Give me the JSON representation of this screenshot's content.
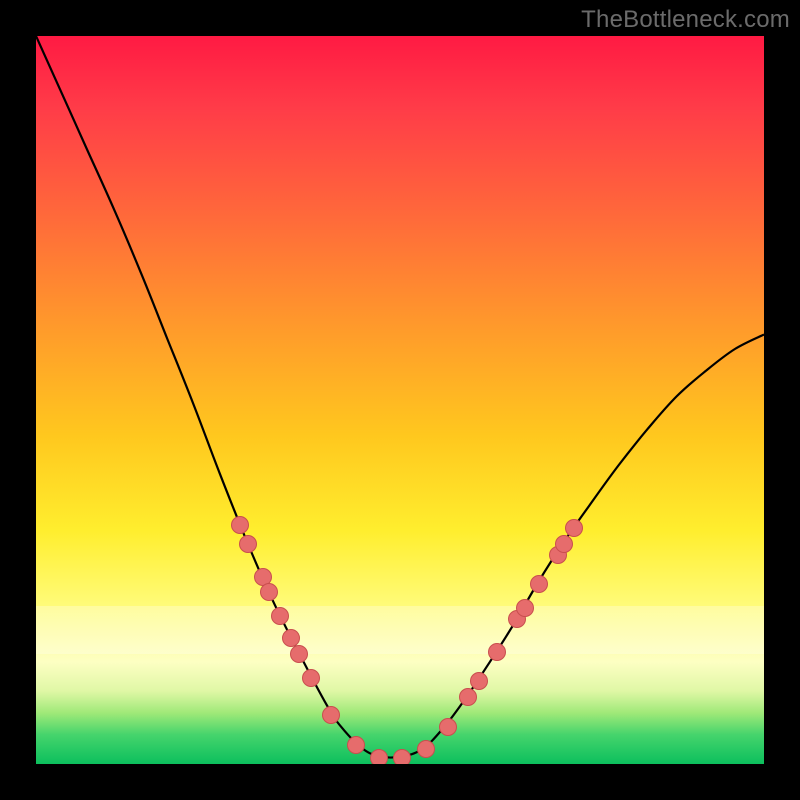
{
  "watermark": "TheBottleneck.com",
  "colors": {
    "dot_fill": "#e66c6c",
    "dot_stroke": "#c94e4e",
    "curve": "#000000"
  },
  "chart_data": {
    "type": "line",
    "title": "",
    "xlabel": "",
    "ylabel": "",
    "xlim": [
      0,
      1
    ],
    "ylim": [
      0,
      1
    ],
    "series": [
      {
        "name": "curve",
        "x": [
          0.0,
          0.036,
          0.072,
          0.108,
          0.144,
          0.18,
          0.216,
          0.252,
          0.29,
          0.325,
          0.36,
          0.4,
          0.42,
          0.45,
          0.475,
          0.5,
          0.53,
          0.56,
          0.59,
          0.62,
          0.655,
          0.69,
          0.725,
          0.76,
          0.8,
          0.84,
          0.88,
          0.92,
          0.96,
          1.0
        ],
        "y": [
          1.0,
          0.92,
          0.84,
          0.76,
          0.675,
          0.585,
          0.495,
          0.4,
          0.305,
          0.225,
          0.155,
          0.08,
          0.05,
          0.02,
          0.01,
          0.01,
          0.02,
          0.05,
          0.09,
          0.135,
          0.19,
          0.25,
          0.305,
          0.355,
          0.41,
          0.46,
          0.505,
          0.54,
          0.57,
          0.59
        ]
      }
    ],
    "points": [
      {
        "name": "left-dot-1",
        "x": 0.279,
        "y": 0.33
      },
      {
        "name": "left-dot-2",
        "x": 0.29,
        "y": 0.304
      },
      {
        "name": "left-dot-3",
        "x": 0.31,
        "y": 0.258
      },
      {
        "name": "left-dot-4",
        "x": 0.318,
        "y": 0.238
      },
      {
        "name": "left-dot-5",
        "x": 0.334,
        "y": 0.204
      },
      {
        "name": "left-dot-6",
        "x": 0.349,
        "y": 0.175
      },
      {
        "name": "left-dot-7",
        "x": 0.36,
        "y": 0.152
      },
      {
        "name": "left-dot-8",
        "x": 0.376,
        "y": 0.12
      },
      {
        "name": "left-dot-9",
        "x": 0.404,
        "y": 0.068
      },
      {
        "name": "bottom-dot-1",
        "x": 0.438,
        "y": 0.028
      },
      {
        "name": "bottom-dot-2",
        "x": 0.47,
        "y": 0.01
      },
      {
        "name": "bottom-dot-3",
        "x": 0.502,
        "y": 0.01
      },
      {
        "name": "bottom-dot-4",
        "x": 0.534,
        "y": 0.022
      },
      {
        "name": "bottom-dot-5",
        "x": 0.565,
        "y": 0.052
      },
      {
        "name": "right-dot-1",
        "x": 0.592,
        "y": 0.094
      },
      {
        "name": "right-dot-2",
        "x": 0.607,
        "y": 0.115
      },
      {
        "name": "right-dot-3",
        "x": 0.632,
        "y": 0.155
      },
      {
        "name": "right-dot-4",
        "x": 0.66,
        "y": 0.2
      },
      {
        "name": "right-dot-5",
        "x": 0.67,
        "y": 0.215
      },
      {
        "name": "right-dot-6",
        "x": 0.69,
        "y": 0.248
      },
      {
        "name": "right-dot-7",
        "x": 0.715,
        "y": 0.288
      },
      {
        "name": "right-dot-8",
        "x": 0.724,
        "y": 0.304
      },
      {
        "name": "right-dot-9",
        "x": 0.737,
        "y": 0.325
      }
    ]
  }
}
